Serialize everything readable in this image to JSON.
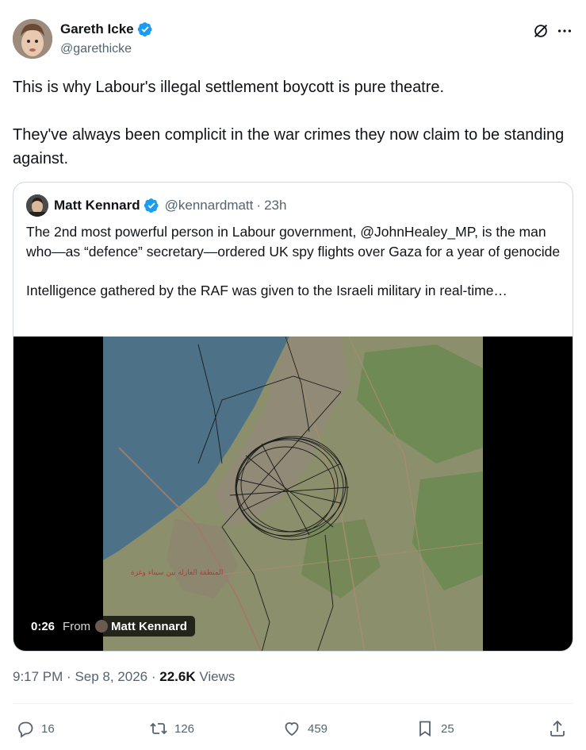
{
  "tweet": {
    "author_name": "Gareth Icke",
    "author_handle": "@garethicke",
    "text_line1": "This is why Labour's illegal settlement boycott is pure theatre.",
    "text_line2": "They've always been complicit in the war crimes they now claim to be standing against.",
    "time": "9:17 PM",
    "date": "Sep 8, 2026",
    "views_count": "22.6K",
    "views_label": "Views"
  },
  "quote": {
    "author_name": "Matt Kennard",
    "author_handle": "@kennardmatt",
    "age": "23h",
    "text_para1": "The 2nd most powerful person in Labour government, @JohnHealey_MP, is the man who—as “defence” secretary—ordered UK spy flights over Gaza for a year of genocide",
    "text_para2": "Intelligence gathered by the RAF was given to the Israeli military in real-time…",
    "video": {
      "duration": "0:26",
      "from_label": "From",
      "from_name": "Matt Kennard",
      "map_label": "المنطقة العازلة بين سيناء وغزة"
    }
  },
  "actions": {
    "replies": "16",
    "reposts": "126",
    "likes": "459",
    "bookmarks": "25"
  },
  "icons": {
    "verified": "verified-badge-icon",
    "grok": "grok-icon",
    "more": "more-icon",
    "reply": "reply-icon",
    "repost": "repost-icon",
    "like": "like-icon",
    "bookmark": "bookmark-icon",
    "share": "share-icon"
  },
  "colors": {
    "verified_blue": "#1d9bf0",
    "secondary_text": "#536471",
    "primary_text": "#0f1419",
    "border": "#cfd9de"
  }
}
